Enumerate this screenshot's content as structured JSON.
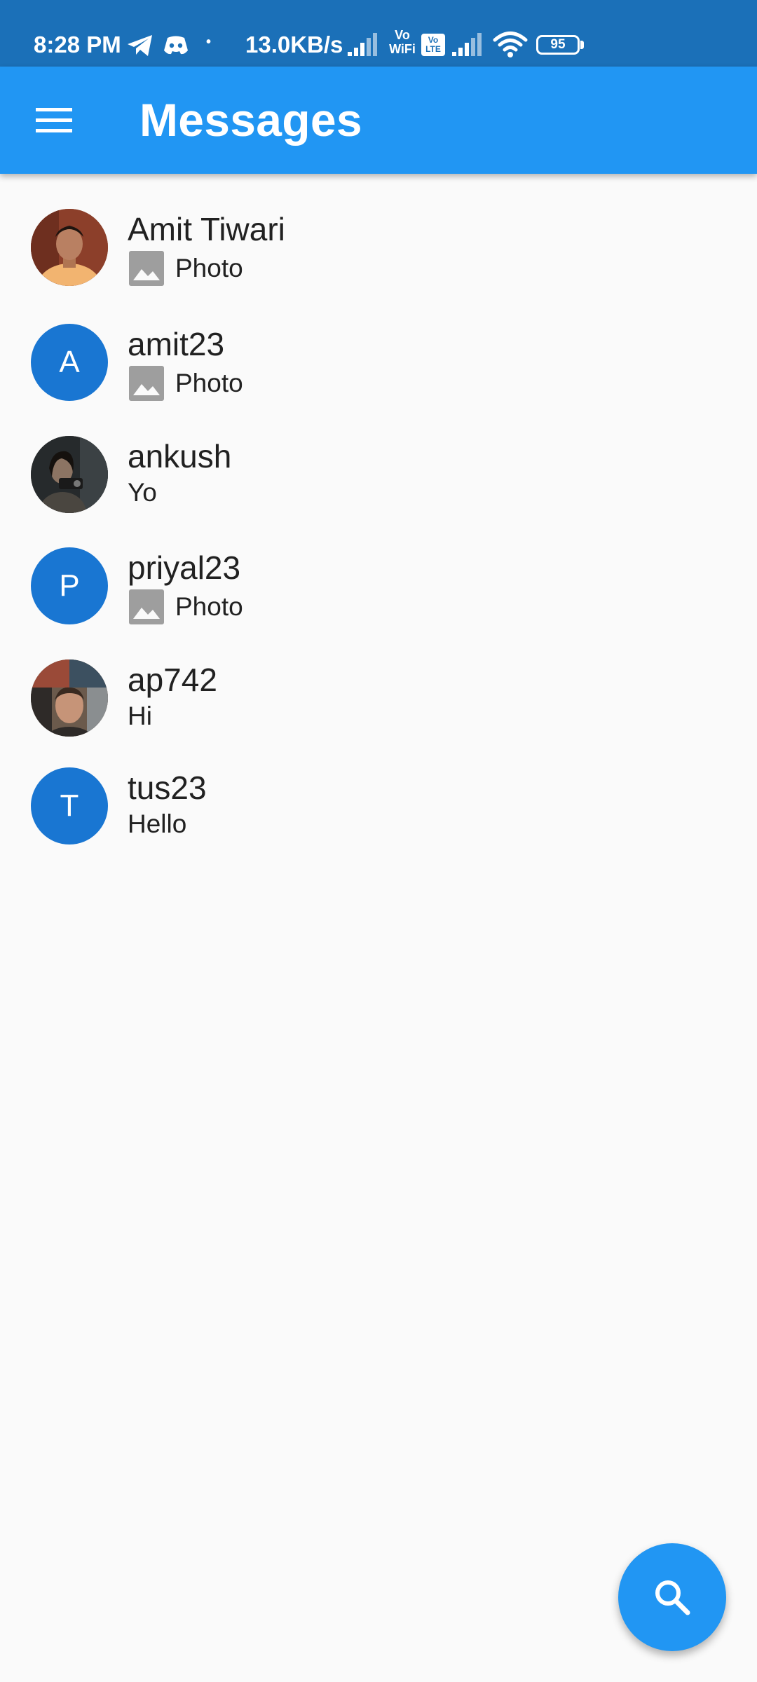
{
  "status_bar": {
    "time": "8:28 PM",
    "network_speed": "13.0KB/s",
    "vowifi_label_top": "Vo",
    "vowifi_label_bottom": "WiFi",
    "volte_label_top": "Vo",
    "volte_label_bottom": "LTE",
    "battery_level": "95",
    "dot": "•"
  },
  "app_bar": {
    "title": "Messages",
    "menu_icon": "menu-icon"
  },
  "conversations": [
    {
      "name": "Amit Tiwari",
      "preview": "Photo",
      "preview_type": "photo",
      "avatar_type": "image",
      "avatar_letter": ""
    },
    {
      "name": "amit23",
      "preview": "Photo",
      "preview_type": "photo",
      "avatar_type": "letter",
      "avatar_letter": "A"
    },
    {
      "name": "ankush",
      "preview": "Yo",
      "preview_type": "text",
      "avatar_type": "image",
      "avatar_letter": ""
    },
    {
      "name": "priyal23",
      "preview": "Photo",
      "preview_type": "photo",
      "avatar_type": "letter",
      "avatar_letter": "P"
    },
    {
      "name": "ap742",
      "preview": "Hi",
      "preview_type": "text",
      "avatar_type": "image",
      "avatar_letter": ""
    },
    {
      "name": "tus23",
      "preview": "Hello",
      "preview_type": "text",
      "avatar_type": "letter",
      "avatar_letter": "T"
    }
  ],
  "fab": {
    "icon": "search-icon"
  },
  "colors": {
    "status_bar": "#1b70b8",
    "app_bar": "#2196f3",
    "avatar_letter_bg": "#1976d2",
    "background": "#fafafa",
    "photo_icon": "#9e9e9e"
  }
}
